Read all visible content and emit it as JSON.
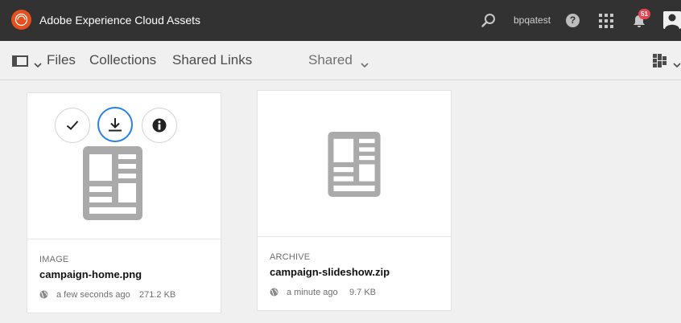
{
  "shell": {
    "app_title": "Adobe Experience Cloud Assets",
    "username": "bpqatest",
    "help_glyph": "?",
    "notification_count": "51",
    "icons": [
      "adobe-logo-icon",
      "search-icon",
      "help-icon",
      "apps-grid-icon",
      "bell-icon",
      "user-avatar-icon"
    ]
  },
  "actionbar": {
    "tabs": [
      {
        "label": "Files"
      },
      {
        "label": "Collections"
      },
      {
        "label": "Shared Links"
      }
    ],
    "filter_label": "Shared"
  },
  "colors": {
    "shell_bg": "#323232",
    "logo": "#e7501e",
    "badge": "#e34850",
    "accent": "#2680eb",
    "placeholder_icon": "#aaaaaa"
  },
  "cards": [
    {
      "type": "IMAGE",
      "title": "campaign-home.png",
      "time": "a few seconds ago",
      "size": "271.2 KB",
      "quick_actions": [
        "select-check-icon",
        "download-icon",
        "info-icon"
      ]
    },
    {
      "type": "ARCHIVE",
      "title": "campaign-slideshow.zip",
      "time": "a minute ago",
      "size": "9.7 KB"
    }
  ]
}
